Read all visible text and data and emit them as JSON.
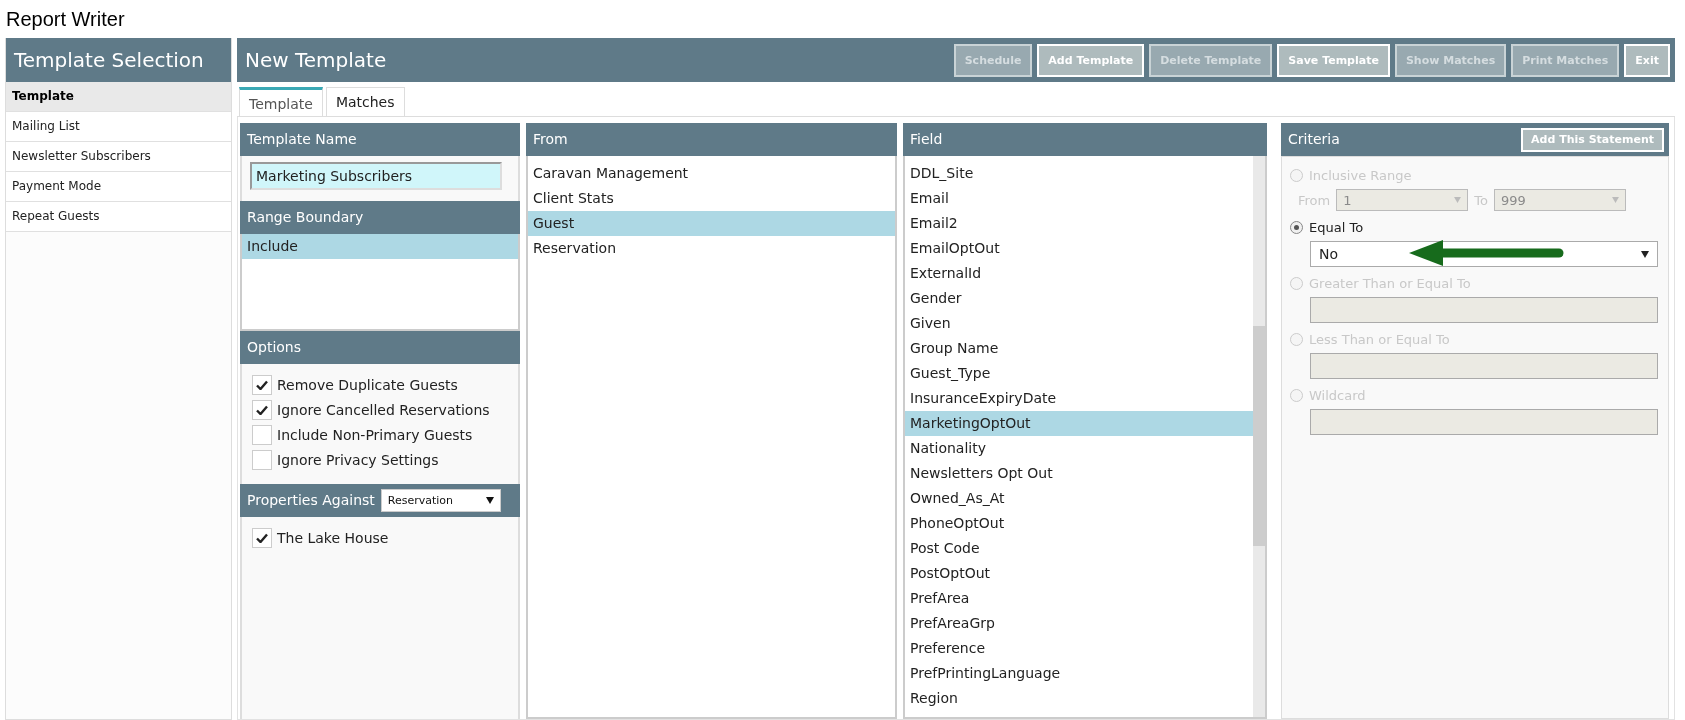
{
  "app_title": "Report Writer",
  "sidebar": {
    "title": "Template Selection",
    "items": [
      {
        "label": "Template",
        "selected": true
      },
      {
        "label": "Mailing List",
        "selected": false
      },
      {
        "label": "Newsletter Subscribers",
        "selected": false
      },
      {
        "label": "Payment Mode",
        "selected": false
      },
      {
        "label": "Repeat Guests",
        "selected": false
      }
    ]
  },
  "main": {
    "title": "New Template",
    "buttons": [
      {
        "label": "Schedule",
        "disabled": true
      },
      {
        "label": "Add Template",
        "disabled": false
      },
      {
        "label": "Delete Template",
        "disabled": true
      },
      {
        "label": "Save Template",
        "disabled": false
      },
      {
        "label": "Show Matches",
        "disabled": true
      },
      {
        "label": "Print Matches",
        "disabled": true
      },
      {
        "label": "Exit",
        "disabled": false
      }
    ]
  },
  "tabs": [
    {
      "label": "Template",
      "selected": true
    },
    {
      "label": "Matches",
      "selected": false
    }
  ],
  "template_name": {
    "title": "Template Name",
    "value": "Marketing Subscribers"
  },
  "range_boundary": {
    "title": "Range Boundary",
    "items": [
      {
        "label": "Include",
        "selected": true
      }
    ]
  },
  "options": {
    "title": "Options",
    "items": [
      {
        "label": "Remove Duplicate Guests",
        "checked": true
      },
      {
        "label": "Ignore Cancelled Reservations",
        "checked": true
      },
      {
        "label": "Include Non-Primary Guests",
        "checked": false
      },
      {
        "label": "Ignore Privacy Settings",
        "checked": false
      }
    ]
  },
  "properties": {
    "title": "Properties Against",
    "select": "Reservation",
    "items": [
      {
        "label": "The Lake House",
        "checked": true
      }
    ]
  },
  "from": {
    "title": "From",
    "items": [
      {
        "label": "Caravan Management",
        "selected": false
      },
      {
        "label": "Client Stats",
        "selected": false
      },
      {
        "label": "Guest",
        "selected": true
      },
      {
        "label": "Reservation",
        "selected": false
      }
    ]
  },
  "field": {
    "title": "Field",
    "items": [
      {
        "label": "DDL_Site",
        "selected": false
      },
      {
        "label": "Email",
        "selected": false
      },
      {
        "label": "Email2",
        "selected": false
      },
      {
        "label": "EmailOptOut",
        "selected": false
      },
      {
        "label": "ExternalId",
        "selected": false
      },
      {
        "label": "Gender",
        "selected": false
      },
      {
        "label": "Given",
        "selected": false
      },
      {
        "label": "Group Name",
        "selected": false
      },
      {
        "label": "Guest_Type",
        "selected": false
      },
      {
        "label": "InsuranceExpiryDate",
        "selected": false
      },
      {
        "label": "MarketingOptOut",
        "selected": true
      },
      {
        "label": "Nationality",
        "selected": false
      },
      {
        "label": "Newsletters Opt Out",
        "selected": false
      },
      {
        "label": "Owned_As_At",
        "selected": false
      },
      {
        "label": "PhoneOptOut",
        "selected": false
      },
      {
        "label": "Post Code",
        "selected": false
      },
      {
        "label": "PostOptOut",
        "selected": false
      },
      {
        "label": "PrefArea",
        "selected": false
      },
      {
        "label": "PrefAreaGrp",
        "selected": false
      },
      {
        "label": "Preference",
        "selected": false
      },
      {
        "label": "PrefPrintingLanguage",
        "selected": false
      },
      {
        "label": "Region",
        "selected": false
      }
    ]
  },
  "criteria": {
    "title": "Criteria",
    "button": "Add This Statement",
    "options": [
      {
        "kind": "range",
        "label": "Inclusive Range",
        "selected": false,
        "disabled": true,
        "from_label": "From",
        "from": "1",
        "to_label": "To",
        "to": "999"
      },
      {
        "kind": "select",
        "label": "Equal To",
        "selected": true,
        "disabled": false,
        "value": "No"
      },
      {
        "kind": "text",
        "label": "Greater Than or Equal To",
        "selected": false,
        "disabled": true
      },
      {
        "kind": "text",
        "label": "Less Than or Equal To",
        "selected": false,
        "disabled": true
      },
      {
        "kind": "text",
        "label": "Wildcard",
        "selected": false,
        "disabled": true
      }
    ]
  }
}
